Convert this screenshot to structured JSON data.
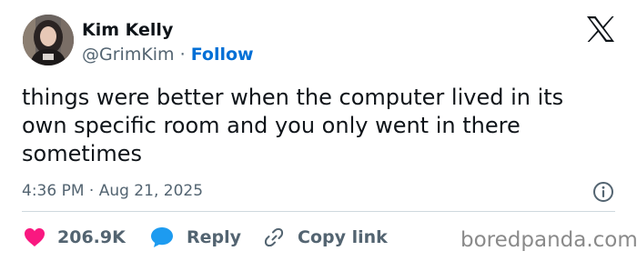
{
  "author": {
    "display_name": "Kim Kelly",
    "handle": "@GrimKim",
    "separator": "·",
    "follow_label": "Follow"
  },
  "icons": {
    "platform_logo": "x-logo-icon",
    "info": "info-icon",
    "like": "heart-icon",
    "reply": "speech-bubble-icon",
    "copy_link": "link-icon"
  },
  "tweet": {
    "text": "things were better when the computer lived in its own specific room and you only went in there sometimes",
    "timestamp": "4:36 PM · Aug 21, 2025"
  },
  "actions": {
    "like_count": "206.9K",
    "reply_label": "Reply",
    "copy_link_label": "Copy link"
  },
  "watermark": "boredpanda.com",
  "colors": {
    "text": "#0f1419",
    "secondary": "#536471",
    "follow_blue": "#006fd6",
    "like_pink": "#f91880",
    "reply_blue": "#1d9bf0",
    "divider": "#cfd9de",
    "watermark": "#8a8a8a"
  }
}
